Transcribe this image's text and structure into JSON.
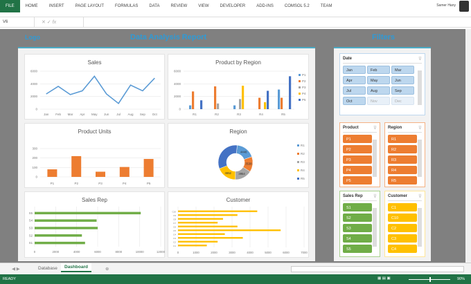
{
  "ribbon": {
    "tabs": [
      "FILE",
      "HOME",
      "INSERT",
      "PAGE LAYOUT",
      "FORMULAS",
      "DATA",
      "REVIEW",
      "VIEW",
      "DEVELOPER",
      "ADD-INS",
      "COMSOL 5.2",
      "TEAM"
    ],
    "user": "Samer Hany"
  },
  "formula_bar": {
    "name_box": "V6",
    "fx": "fx",
    "value": ""
  },
  "dashboard": {
    "logo": "Logo",
    "title": "Data Analysis Report",
    "filters_title": "Filters"
  },
  "colors": {
    "P1": "#5b9bd5",
    "P2": "#ed7d31",
    "P3": "#a5a5a5",
    "P4": "#ffc000",
    "P5": "#4472c4",
    "green": "#70ad47",
    "accent": "#217346"
  },
  "chart_data": [
    {
      "type": "line",
      "title": "Sales",
      "categories": [
        "Jan",
        "Feb",
        "Mar",
        "Apr",
        "May",
        "Jun",
        "Jul",
        "Aug",
        "Sep",
        "Oct"
      ],
      "values": [
        2400,
        3600,
        2300,
        2900,
        5200,
        2400,
        900,
        3800,
        2900,
        4900
      ],
      "ylim": [
        0,
        6000
      ],
      "yticks": [
        "0",
        "2000",
        "4000",
        "6000"
      ]
    },
    {
      "type": "bar",
      "title": "Product by Region",
      "categories": [
        "R1",
        "R2",
        "R3",
        "R4",
        "R5"
      ],
      "ylim": [
        0,
        6000
      ],
      "yticks": [
        "0",
        "2000",
        "4000",
        "6000"
      ],
      "series": [
        {
          "name": "P1",
          "values": [
            600,
            0,
            600,
            0,
            3100
          ]
        },
        {
          "name": "P2",
          "values": [
            2800,
            3600,
            0,
            1800,
            1800
          ]
        },
        {
          "name": "P3",
          "values": [
            0,
            900,
            1600,
            0,
            0
          ]
        },
        {
          "name": "P4",
          "values": [
            0,
            0,
            3700,
            1100,
            0
          ]
        },
        {
          "name": "P5",
          "values": [
            1400,
            0,
            0,
            2900,
            5200
          ]
        }
      ]
    },
    {
      "type": "bar",
      "title": "Product Units",
      "categories": [
        "P1",
        "P2",
        "P3",
        "P4",
        "P5"
      ],
      "values": [
        80,
        220,
        55,
        105,
        190
      ],
      "ylim": [
        0,
        300
      ],
      "yticks": [
        "0",
        "100",
        "200",
        "300"
      ]
    },
    {
      "type": "pie",
      "title": "Region",
      "categories": [
        "R1",
        "R2",
        "R3",
        "R4",
        "R5"
      ],
      "values": [
        4448,
        3538,
        3954,
        4652,
        8000
      ],
      "labels": [
        "4448",
        "3538",
        "3954",
        "4652",
        ""
      ]
    },
    {
      "type": "bar",
      "orientation": "horizontal",
      "title": "Sales Rep",
      "categories": [
        "S5",
        "S4",
        "S3",
        "S2",
        "S1"
      ],
      "values": [
        10100,
        5900,
        6000,
        4500,
        4800
      ],
      "xlim": [
        0,
        12000
      ],
      "xticks": [
        "0",
        "2000",
        "4000",
        "6000",
        "8000",
        "10000",
        "12000"
      ]
    },
    {
      "type": "bar",
      "orientation": "horizontal",
      "title": "Customer",
      "categories": [
        "C10",
        "C9",
        "C8",
        "C7",
        "C6",
        "C5",
        "C4",
        "C3",
        "C2",
        "C1"
      ],
      "values": [
        4400,
        3300,
        2500,
        2200,
        3300,
        5700,
        2600,
        3600,
        2200,
        1600
      ],
      "xlim": [
        0,
        7000
      ],
      "xticks": [
        "0",
        "1000",
        "2000",
        "3000",
        "4000",
        "5000",
        "6000",
        "7000"
      ]
    }
  ],
  "slicers": {
    "date": {
      "title": "Date",
      "items": [
        "Jan",
        "Feb",
        "Mar",
        "Apr",
        "May",
        "Jun",
        "Jul",
        "Aug",
        "Sep",
        "Oct",
        "Nov",
        "Dec"
      ]
    },
    "product": {
      "title": "Product",
      "items": [
        "P1",
        "P2",
        "P3",
        "P4",
        "P5"
      ]
    },
    "region": {
      "title": "Region",
      "items": [
        "R1",
        "R2",
        "R3",
        "R4",
        "R5"
      ]
    },
    "sales_rep": {
      "title": "Sales Rep",
      "items": [
        "S1",
        "S2",
        "S3",
        "S4",
        "S5"
      ]
    },
    "customer": {
      "title": "Customer",
      "items": [
        "C1",
        "C10",
        "C2",
        "C3",
        "C4"
      ]
    }
  },
  "sheets": {
    "tabs": [
      "Database",
      "Dashboard"
    ],
    "active": "Dashboard"
  },
  "status": {
    "ready": "READY",
    "zoom": "90%"
  }
}
